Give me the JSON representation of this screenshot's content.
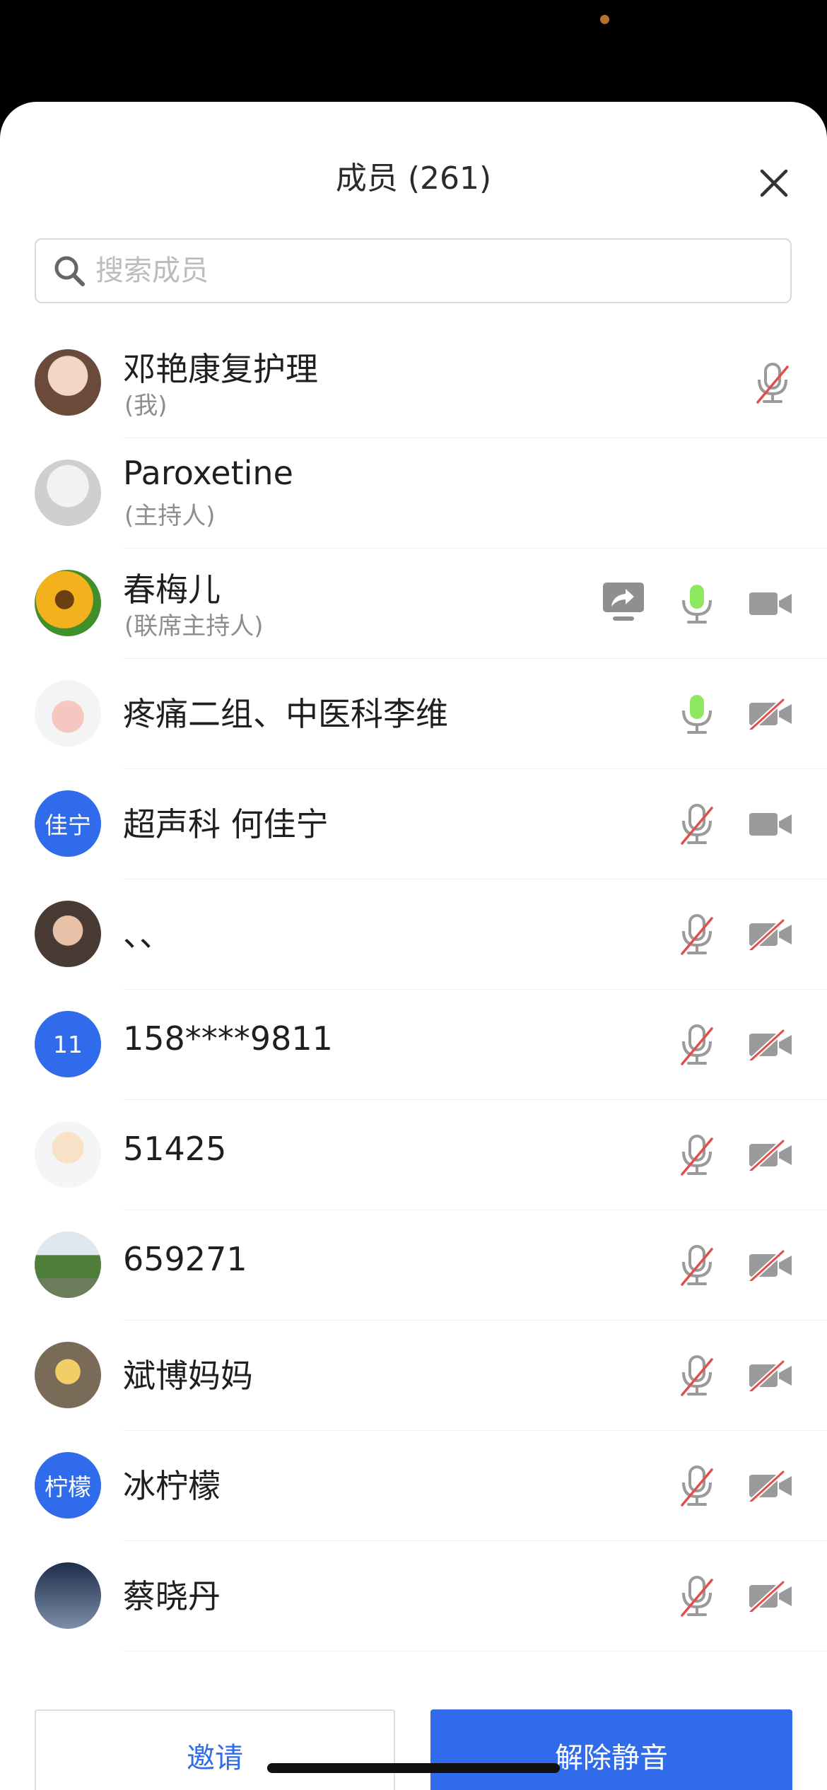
{
  "header": {
    "title": "成员 (261)"
  },
  "search": {
    "placeholder": "搜索成员"
  },
  "members": [
    {
      "name": "邓艳康复护理",
      "role": "(我)",
      "avatar_text": "",
      "mic": "muted",
      "video": "none",
      "share": false
    },
    {
      "name": "Paroxetine",
      "role": "(主持人)",
      "avatar_text": "",
      "mic": "none",
      "video": "none",
      "share": false
    },
    {
      "name": "春梅儿",
      "role": "(联席主持人)",
      "avatar_text": "",
      "mic": "active",
      "video": "on",
      "share": true
    },
    {
      "name": "疼痛二组、中医科李维",
      "role": "",
      "avatar_text": "",
      "mic": "active",
      "video": "off",
      "share": false
    },
    {
      "name": "超声科 何佳宁",
      "role": "",
      "avatar_text": "佳宁",
      "mic": "muted",
      "video": "on",
      "share": false
    },
    {
      "name": "、、",
      "role": "",
      "avatar_text": "",
      "mic": "muted",
      "video": "off",
      "share": false
    },
    {
      "name": "158****9811",
      "role": "",
      "avatar_text": "11",
      "mic": "muted",
      "video": "off",
      "share": false
    },
    {
      "name": "51425",
      "role": "",
      "avatar_text": "",
      "mic": "muted",
      "video": "off",
      "share": false
    },
    {
      "name": "659271",
      "role": "",
      "avatar_text": "",
      "mic": "muted",
      "video": "off",
      "share": false
    },
    {
      "name": "斌博妈妈",
      "role": "",
      "avatar_text": "",
      "mic": "muted",
      "video": "off",
      "share": false
    },
    {
      "name": "冰柠檬",
      "role": "",
      "avatar_text": "柠檬",
      "mic": "muted",
      "video": "off",
      "share": false
    },
    {
      "name": "蔡晓丹",
      "role": "",
      "avatar_text": "",
      "mic": "muted",
      "video": "off",
      "share": false
    }
  ],
  "footer": {
    "invite_label": "邀请",
    "unmute_all_label": "解除静音"
  },
  "colors": {
    "accent": "#2f6bea",
    "mic_active": "#8ee85f",
    "muted_slash": "#e0504a",
    "icon_gray": "#9a9a9a"
  }
}
